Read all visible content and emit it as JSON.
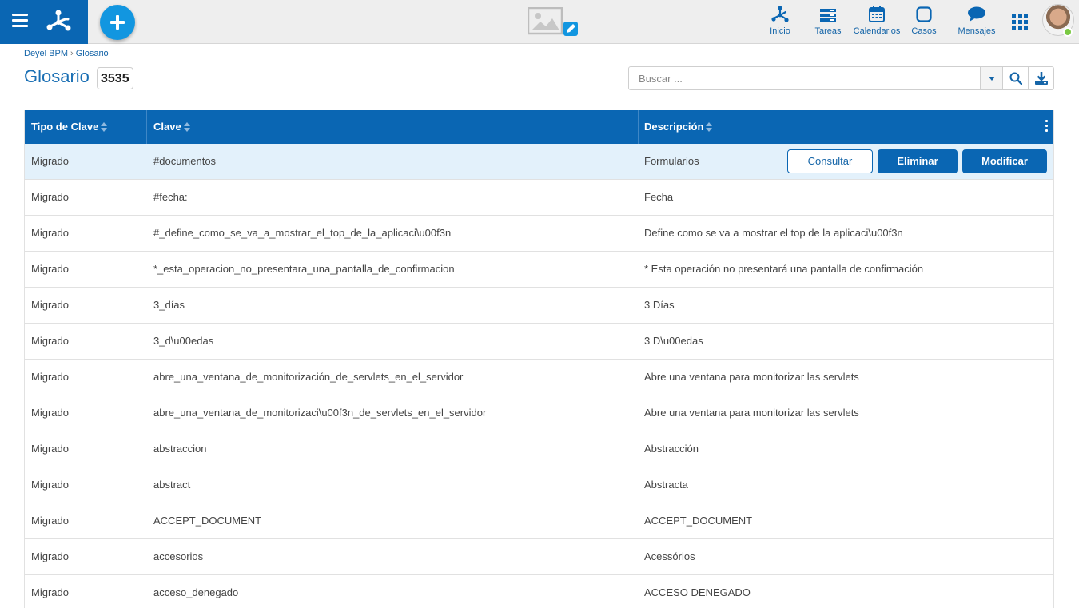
{
  "topbar": {
    "nav": [
      {
        "label": "Inicio",
        "icon": "network-icon"
      },
      {
        "label": "Tareas",
        "icon": "tasks-icon"
      },
      {
        "label": "Calendarios",
        "icon": "calendar-icon"
      },
      {
        "label": "Casos",
        "icon": "square-icon"
      },
      {
        "label": "Mensajes",
        "icon": "chat-bubble-icon"
      }
    ]
  },
  "breadcrumb": {
    "root": "Deyel BPM",
    "separator": "›",
    "current": "Glosario"
  },
  "page": {
    "title": "Glosario",
    "count": "3535"
  },
  "search": {
    "placeholder": "Buscar ..."
  },
  "table": {
    "columns": [
      "Tipo de Clave",
      "Clave",
      "Descripción"
    ],
    "actions": {
      "consult": "Consultar",
      "delete": "Eliminar",
      "modify": "Modificar"
    },
    "rows": [
      {
        "tipo": "Migrado",
        "clave": "#documentos",
        "descripcion": "Formularios"
      },
      {
        "tipo": "Migrado",
        "clave": "#fecha:",
        "descripcion": "Fecha"
      },
      {
        "tipo": "Migrado",
        "clave": "#_define_como_se_va_a_mostrar_el_top_de_la_aplicaci\\u00f3n",
        "descripcion": "Define como se va a mostrar el top de la aplicaci\\u00f3n"
      },
      {
        "tipo": "Migrado",
        "clave": "*_esta_operacion_no_presentara_una_pantalla_de_confirmacion",
        "descripcion": "* Esta operación no presentará una pantalla de confirmación"
      },
      {
        "tipo": "Migrado",
        "clave": "3_días",
        "descripcion": "3 Días"
      },
      {
        "tipo": "Migrado",
        "clave": "3_d\\u00edas",
        "descripcion": "3 D\\u00edas"
      },
      {
        "tipo": "Migrado",
        "clave": "abre_una_ventana_de_monitorización_de_servlets_en_el_servidor",
        "descripcion": "Abre una ventana para monitorizar las servlets"
      },
      {
        "tipo": "Migrado",
        "clave": "abre_una_ventana_de_monitorizaci\\u00f3n_de_servlets_en_el_servidor",
        "descripcion": "Abre una ventana para monitorizar las servlets"
      },
      {
        "tipo": "Migrado",
        "clave": "abstraccion",
        "descripcion": "Abstracción"
      },
      {
        "tipo": "Migrado",
        "clave": "abstract",
        "descripcion": "Abstracta"
      },
      {
        "tipo": "Migrado",
        "clave": "ACCEPT_DOCUMENT",
        "descripcion": "ACCEPT_DOCUMENT"
      },
      {
        "tipo": "Migrado",
        "clave": "accesorios",
        "descripcion": "Acessórios"
      },
      {
        "tipo": "Migrado",
        "clave": "acceso_denegado",
        "descripcion": "ACCESO DENEGADO"
      }
    ]
  },
  "colors": {
    "brand": "#0a66b3",
    "accent": "#1296e0",
    "selected_row": "#e3f1fb",
    "online": "#7ac943"
  }
}
